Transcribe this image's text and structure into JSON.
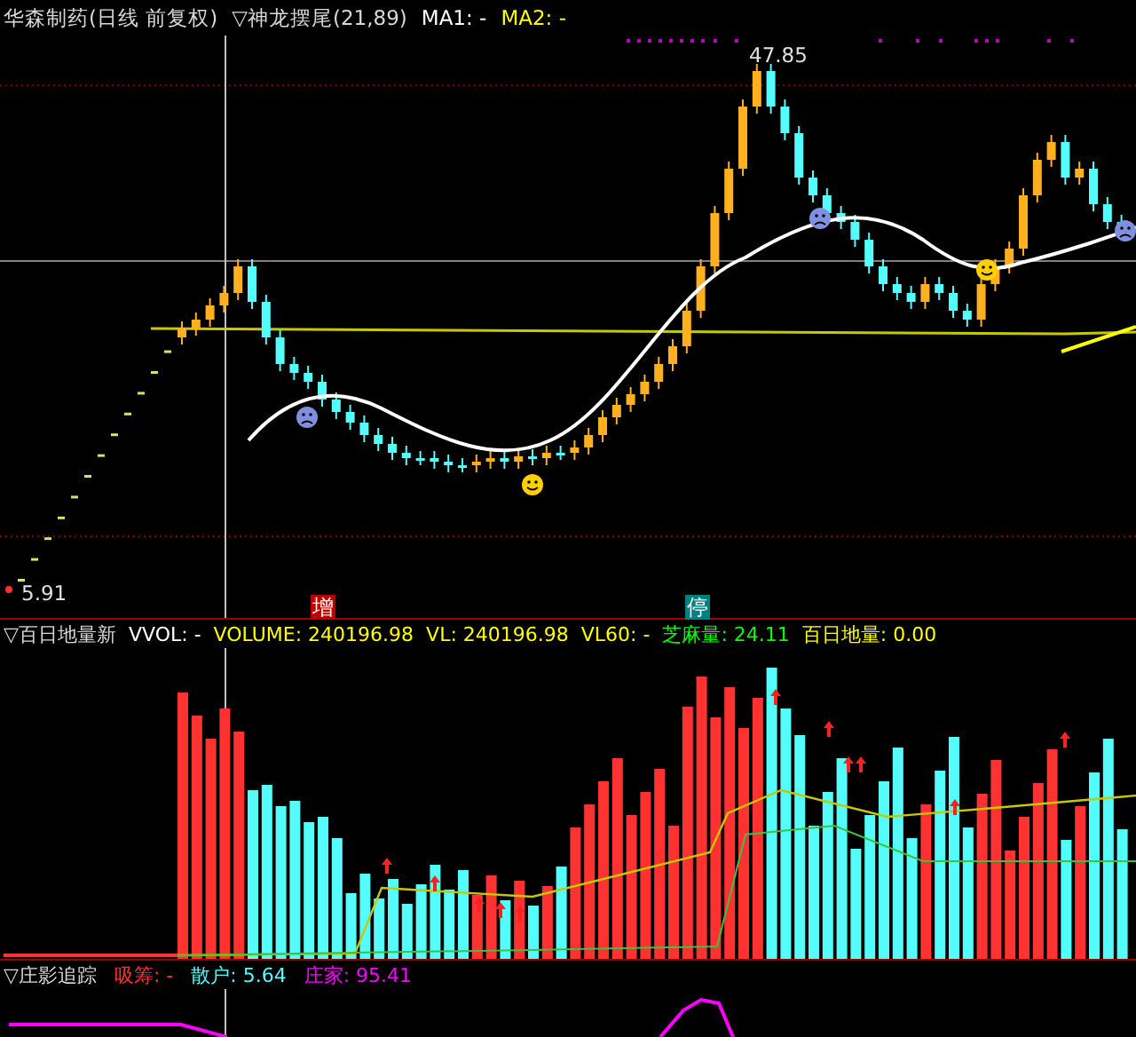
{
  "price_panel": {
    "title": "华森制药(日线 前复权)",
    "indicator": "▽神龙摆尾(21,89)",
    "legends": [
      {
        "label": "MA1: -",
        "color": "#ffffff"
      },
      {
        "label": "MA2: -",
        "color": "#ffff00"
      }
    ],
    "high_label": "47.85",
    "low_label": "5.91",
    "markers": [
      {
        "text": "增",
        "color": "#c00000"
      },
      {
        "text": "停",
        "color": "#008080"
      }
    ]
  },
  "volume_panel": {
    "title": "▽百日地量新",
    "legends": [
      {
        "label": "VVOL: -",
        "color": "#ffffff"
      },
      {
        "label": "VOLUME: 240196.98",
        "color": "#ffff00"
      },
      {
        "label": "VL: 240196.98",
        "color": "#ffff00"
      },
      {
        "label": "VL60: -",
        "color": "#ffff00"
      },
      {
        "label": "芝麻量: 24.11",
        "color": "#00ff00"
      },
      {
        "label": "百日地量: 0.00",
        "color": "#ffff00"
      }
    ]
  },
  "tracking_panel": {
    "title": "▽庄影追踪",
    "legends": [
      {
        "label": "吸筹: -",
        "color": "#ff3232"
      },
      {
        "label": "散户: 5.64",
        "color": "#54fcfc"
      },
      {
        "label": "庄家: 95.41",
        "color": "#ff00ff"
      }
    ]
  }
}
